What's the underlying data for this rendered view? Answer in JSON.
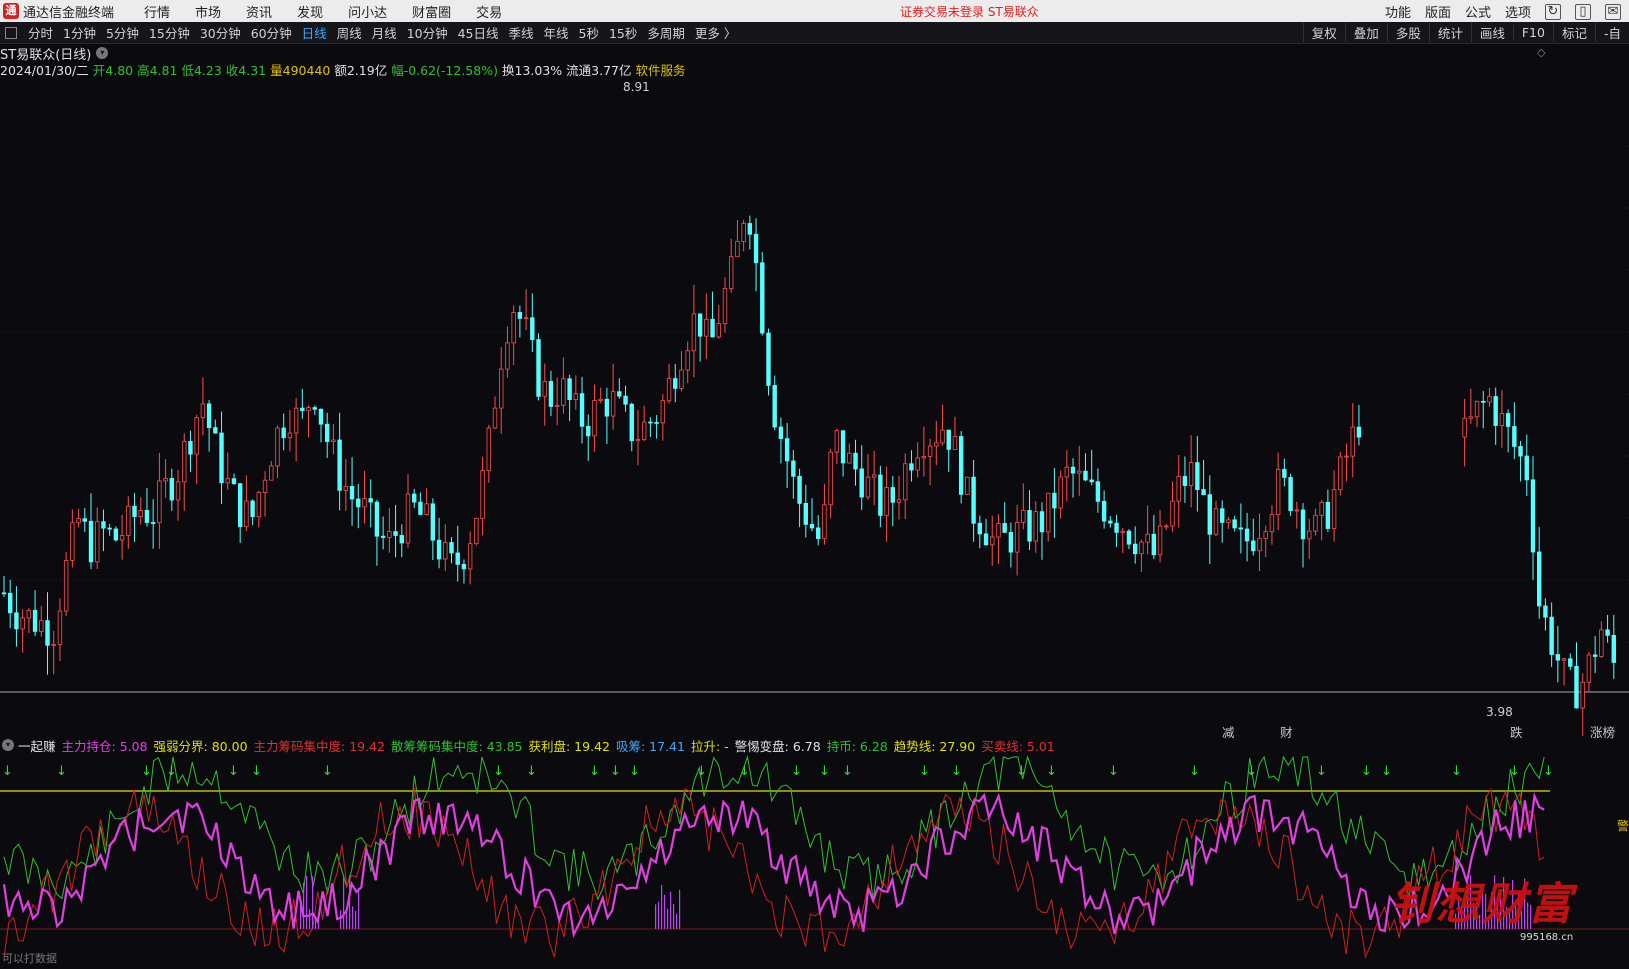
{
  "titlebar": {
    "app_title": "通达信金融终端",
    "menus": [
      "行情",
      "市场",
      "资讯",
      "发现",
      "问小达",
      "财富圈",
      "交易"
    ],
    "center_status": "证券交易未登录  ST易联众",
    "right_menus": [
      "功能",
      "版面",
      "公式",
      "选项"
    ]
  },
  "toolbar": {
    "periods": [
      "分时",
      "1分钟",
      "5分钟",
      "15分钟",
      "30分钟",
      "60分钟",
      "日线",
      "周线",
      "月线",
      "10分钟",
      "45日线",
      "季线",
      "年线",
      "5秒",
      "15秒",
      "多周期",
      "更多 〉"
    ],
    "active_period": "日线",
    "right_buttons": [
      "复权",
      "叠加",
      "多股",
      "统计",
      "画线",
      "F10",
      "标记",
      "-自"
    ]
  },
  "stock": {
    "name": "ST易联众(日线)",
    "date": "2024/01/30/二",
    "open": "开4.80",
    "high": "高4.81",
    "low": "低4.23",
    "close": "收4.31",
    "volume": "量490440",
    "amount": "额2.19亿",
    "change": "幅-0.62(-12.58%)",
    "turnover": "换13.03%",
    "float": "流通3.77亿",
    "sector": "软件服务"
  },
  "chart_labels": {
    "high_marker": "8.91",
    "low_marker": "3.98"
  },
  "signals": [
    {
      "text": "减",
      "color": "#3adf5a"
    },
    {
      "text": "财",
      "color": "#3fa7ff"
    },
    {
      "text": "跌",
      "color": "#3adf5a"
    },
    {
      "text": "涨榜",
      "color": "#ff5050"
    }
  ],
  "indicator": {
    "name": "一起赚",
    "items": [
      {
        "label": "主力持仓: 5.08",
        "color": "#e040e0"
      },
      {
        "label": "强弱分界: 80.00",
        "color": "#e0e000"
      },
      {
        "label": "主力筹码集中度: 19.42",
        "color": "#e03030"
      },
      {
        "label": "散筹筹码集中度: 43.85",
        "color": "#30c030"
      },
      {
        "label": "获利盘: 19.42",
        "color": "#e0e000"
      },
      {
        "label": "吸筹: 17.41",
        "color": "#3fa7ff"
      },
      {
        "label": "拉升: -",
        "color": "#e0e000"
      },
      {
        "label": "警惕变盘: 6.78",
        "color": "#e0e0e0"
      },
      {
        "label": "持币: 6.28",
        "color": "#30c030"
      },
      {
        "label": "趋势线: 27.90",
        "color": "#e0e000"
      },
      {
        "label": "买卖线: 5.01",
        "color": "#e03030"
      }
    ],
    "right_label": "警",
    "bottom_label": "可以打数据"
  },
  "watermark": {
    "text": "钊想财富",
    "url": "995168.cn"
  },
  "chart_data": {
    "type": "candlestick",
    "title": "ST易联众(日线)",
    "ylim": [
      3.9,
      9.1
    ],
    "high_label": 8.91,
    "low_label": 3.98,
    "close_path": [
      4.9,
      4.75,
      4.7,
      4.65,
      4.6,
      5.1,
      5.5,
      5.3,
      5.4,
      5.35,
      5.45,
      5.6,
      5.55,
      5.75,
      5.9,
      6.2,
      6.5,
      6.1,
      5.8,
      5.6,
      5.5,
      5.9,
      6.2,
      6.4,
      6.3,
      6.6,
      6.2,
      5.9,
      5.7,
      5.6,
      5.4,
      5.3,
      5.45,
      5.6,
      5.5,
      5.3,
      5.1,
      5.2,
      5.5,
      6.0,
      6.8,
      7.3,
      7.1,
      6.7,
      6.5,
      6.6,
      6.4,
      6.3,
      6.45,
      6.5,
      6.35,
      6.2,
      6.3,
      6.4,
      6.7,
      7.0,
      7.2,
      6.9,
      7.3,
      7.6,
      8.2,
      7.4,
      6.5,
      6.1,
      5.7,
      5.5,
      5.3,
      6.2,
      6.0,
      5.9,
      5.75,
      5.6,
      5.7,
      6.0,
      6.2,
      6.2,
      6.3,
      6.0,
      5.6,
      5.5,
      5.3,
      5.35,
      5.4,
      5.45,
      5.5,
      5.7,
      5.9,
      5.8,
      5.7,
      5.6,
      5.5,
      5.4,
      5.3,
      5.2,
      5.5,
      5.8,
      5.9,
      5.6,
      5.4,
      5.35,
      5.3,
      5.4,
      5.6,
      5.8,
      5.7,
      5.5,
      5.4,
      5.6,
      5.9,
      6.2,
      6.5,
      6.9,
      7.1,
      6.9,
      6.7,
      6.5,
      6.3,
      6.0,
      6.2,
      6.4,
      6.5,
      6.3,
      6.1,
      5.9,
      4.8,
      4.5,
      4.2,
      4.05,
      4.3,
      4.6,
      4.31
    ]
  }
}
